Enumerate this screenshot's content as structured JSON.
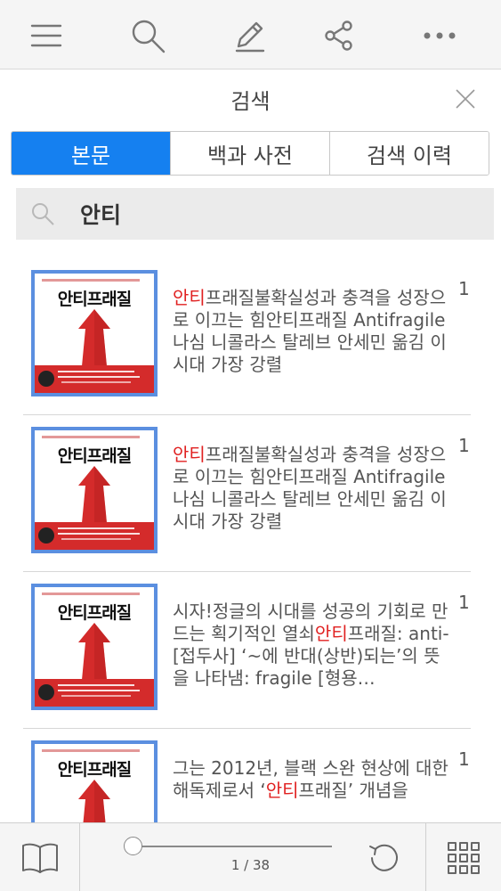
{
  "toolbar": {
    "icons": [
      "menu-icon",
      "search-icon",
      "pencil-icon",
      "share-icon",
      "more-icon"
    ]
  },
  "panel": {
    "title": "검색",
    "tabs": [
      {
        "label": "본문",
        "active": true
      },
      {
        "label": "백과 사전",
        "active": false
      },
      {
        "label": "검색 이력",
        "active": false
      }
    ],
    "search": {
      "value": "안티",
      "placeholder": ""
    }
  },
  "results": [
    {
      "cover_title": "안티프래질",
      "before": "",
      "highlight": "안티",
      "after": "프래질불확실성과 충격을 성장으로 이끄는 힘안티프래질 Antifragile 나심 니콜라스 탈레브 안세민 옮김 이 시대 가장 강렬",
      "page": "1"
    },
    {
      "cover_title": "안티프래질",
      "before": "",
      "highlight": "안티",
      "after": "프래질불확실성과 충격을 성장으로 이끄는 힘안티프래질 Antifragile 나심 니콜라스 탈레브 안세민 옮김 이 시대 가장 강렬",
      "page": "1"
    },
    {
      "cover_title": "안티프래질",
      "before": "시자!정글의 시대를 성공의 기회로 만드는 획기적인 열쇠",
      "highlight": "안티",
      "after": "프래질: anti- [접두사] ‘~에 반대(상반)되는’의 뜻을 나타냄: fragile [형용…",
      "page": "1"
    },
    {
      "cover_title": "안티프래질",
      "before": "그는 2012년, 블랙 스완 현상에 대한 해독제로서 ‘",
      "highlight": "안티",
      "after": "프래질’ 개념을",
      "page": "1"
    }
  ],
  "bottombar": {
    "page_indicator": "1 / 38",
    "progress": 0.0,
    "icons": [
      "book-icon",
      "refresh-icon",
      "grid-icon"
    ]
  },
  "colors": {
    "accent": "#1580f0",
    "highlight": "#e02020",
    "cover_border": "#5b8fe0",
    "cover_red": "#d42b2b"
  }
}
